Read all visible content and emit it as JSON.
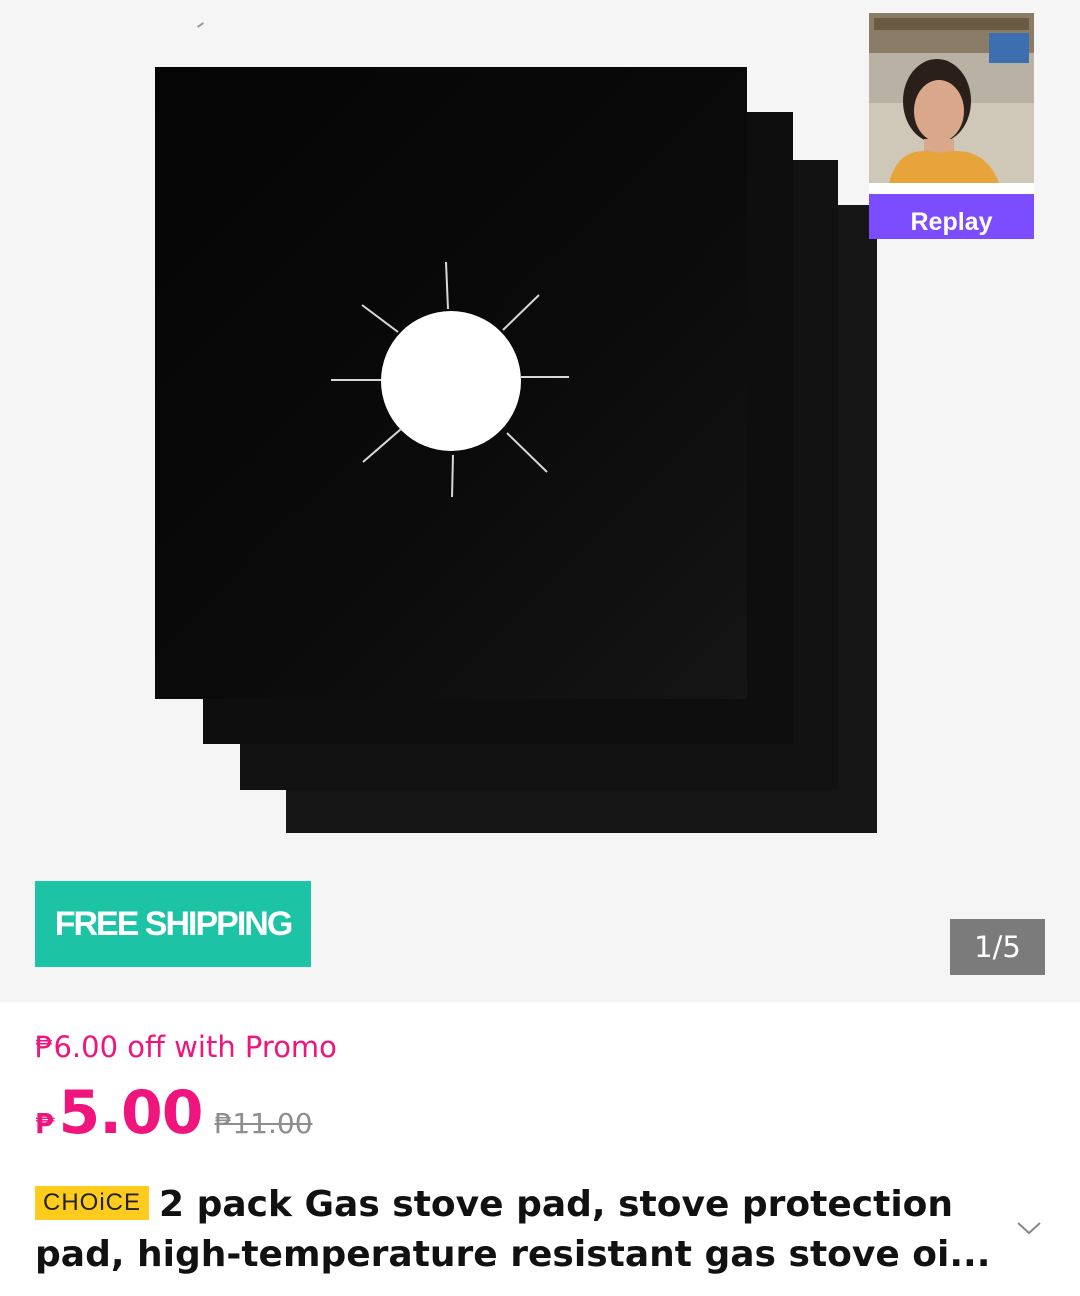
{
  "gallery": {
    "image_alt": "Black gas stove protection pads stacked",
    "replay_label": "Replay",
    "badge_free_shipping": "FREE SHIPPING",
    "page_counter": "1/5"
  },
  "price": {
    "promo_text": "₱6.00 off with Promo",
    "currency_symbol": "₱",
    "current": "5.00",
    "original": "₱11.00",
    "accent_color": "#f0157d"
  },
  "product": {
    "choice_badge": "CHOiCE",
    "title_line1": "2 pack Gas stove pad, stove protection",
    "title_line2": "pad, high-temperature resistant gas stove oi..."
  },
  "colors": {
    "replay_bg": "#7c4dfe",
    "free_shipping_bg": "#1dc3a5",
    "choice_bg": "#ffcc1e"
  }
}
